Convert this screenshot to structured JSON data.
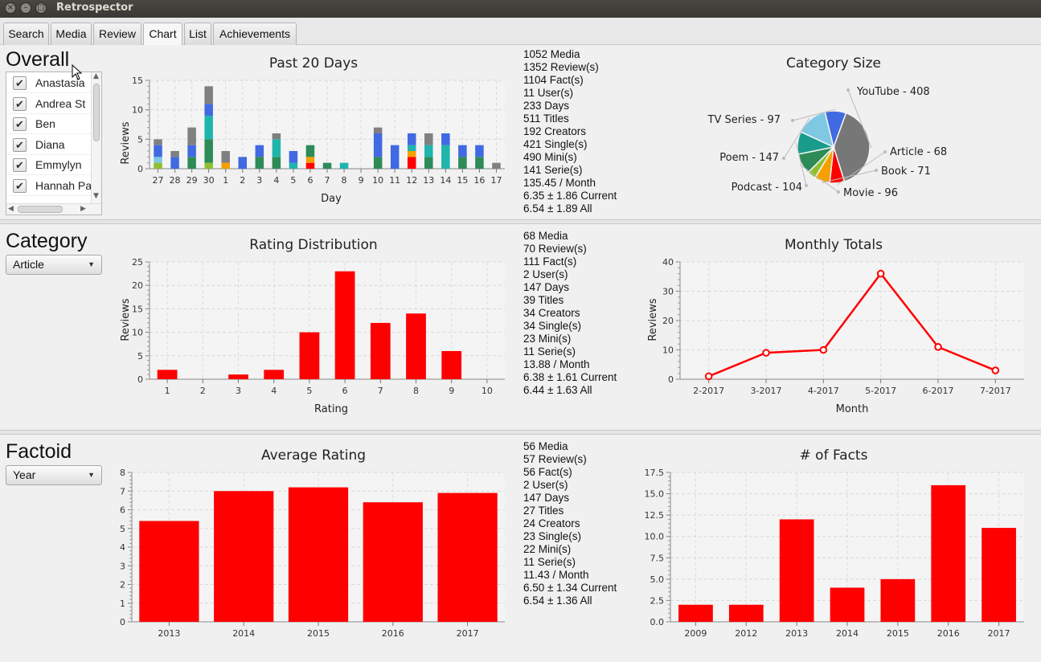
{
  "window": {
    "title": "Retrospector"
  },
  "tabs": [
    "Search",
    "Media",
    "Review",
    "Chart",
    "List",
    "Achievements"
  ],
  "active_tab": "Chart",
  "overall": {
    "title": "Overall",
    "users": [
      "Anastasia",
      "Andrea St",
      "Ben",
      "Diana",
      "Emmylyn",
      "Hannah Pa"
    ],
    "stats": [
      "1052 Media",
      "1352 Review(s)",
      "1104 Fact(s)",
      "11 User(s)",
      "233 Days",
      "511 Titles",
      "192 Creators",
      "421 Single(s)",
      "490 Mini(s)",
      "141 Serie(s)",
      "135.45 / Month",
      "6.35 ± 1.86 Current",
      "6.54 ± 1.89 All"
    ]
  },
  "category": {
    "title": "Category",
    "selected": "Article",
    "stats": [
      "68 Media",
      "70 Review(s)",
      "111 Fact(s)",
      "2 User(s)",
      "147 Days",
      "39 Titles",
      "34 Creators",
      "34 Single(s)",
      "23 Mini(s)",
      "11 Serie(s)",
      "13.88 / Month",
      "6.38 ± 1.61 Current",
      "6.44 ± 1.63 All"
    ]
  },
  "factoid": {
    "title": "Factoid",
    "selected": "Year",
    "stats": [
      "56 Media",
      "57 Review(s)",
      "56 Fact(s)",
      "2 User(s)",
      "147 Days",
      "27 Titles",
      "24 Creators",
      "23 Single(s)",
      "22 Mini(s)",
      "11 Serie(s)",
      "11.43 / Month",
      "6.50 ± 1.34 Current",
      "6.54 ± 1.36 All"
    ]
  },
  "colors": {
    "red": "#ff0000",
    "orange": "#f5a000",
    "yellowgreen": "#8fbf30",
    "darkgreen": "#2e8b57",
    "teal": "#1fb5ad",
    "lightblue": "#7ec8e3",
    "blue": "#4169e1",
    "gray": "#808080",
    "seagreen": "#1a9c8c"
  },
  "chart_data": [
    {
      "type": "bar",
      "stacked": true,
      "title": "Past 20 Days",
      "xlabel": "Day",
      "ylabel": "Reviews",
      "ylim": [
        0,
        15
      ],
      "yticks": [
        0,
        5,
        10,
        15
      ],
      "categories": [
        "27",
        "28",
        "29",
        "30",
        "1",
        "2",
        "3",
        "4",
        "5",
        "6",
        "7",
        "8",
        "9",
        "10",
        "11",
        "12",
        "13",
        "14",
        "15",
        "16",
        "17"
      ],
      "stacks": [
        [
          [
            "yellowgreen",
            1
          ],
          [
            "lightblue",
            1
          ],
          [
            "blue",
            2
          ],
          [
            "gray",
            1
          ]
        ],
        [
          [
            "blue",
            2
          ],
          [
            "gray",
            1
          ]
        ],
        [
          [
            "darkgreen",
            2
          ],
          [
            "blue",
            2
          ],
          [
            "gray",
            3
          ]
        ],
        [
          [
            "yellowgreen",
            1
          ],
          [
            "darkgreen",
            4
          ],
          [
            "teal",
            4
          ],
          [
            "blue",
            2
          ],
          [
            "gray",
            3
          ]
        ],
        [
          [
            "orange",
            1
          ],
          [
            "gray",
            2
          ]
        ],
        [
          [
            "blue",
            2
          ]
        ],
        [
          [
            "darkgreen",
            2
          ],
          [
            "blue",
            2
          ]
        ],
        [
          [
            "darkgreen",
            2
          ],
          [
            "teal",
            3
          ],
          [
            "gray",
            1
          ]
        ],
        [
          [
            "teal",
            1
          ],
          [
            "blue",
            2
          ]
        ],
        [
          [
            "red",
            1
          ],
          [
            "orange",
            1
          ],
          [
            "darkgreen",
            2
          ]
        ],
        [
          [
            "darkgreen",
            1
          ]
        ],
        [
          [
            "teal",
            1
          ]
        ],
        [],
        [
          [
            "darkgreen",
            2
          ],
          [
            "blue",
            4
          ],
          [
            "gray",
            1
          ]
        ],
        [
          [
            "blue",
            4
          ]
        ],
        [
          [
            "red",
            2
          ],
          [
            "orange",
            1
          ],
          [
            "teal",
            1
          ],
          [
            "blue",
            2
          ]
        ],
        [
          [
            "darkgreen",
            2
          ],
          [
            "teal",
            2
          ],
          [
            "gray",
            2
          ]
        ],
        [
          [
            "teal",
            4
          ],
          [
            "blue",
            2
          ]
        ],
        [
          [
            "darkgreen",
            2
          ],
          [
            "blue",
            2
          ]
        ],
        [
          [
            "darkgreen",
            2
          ],
          [
            "blue",
            2
          ]
        ],
        [
          [
            "gray",
            1
          ]
        ]
      ]
    },
    {
      "type": "pie",
      "title": "Category Size",
      "slices": [
        {
          "label": "YouTube - 408",
          "value": 408,
          "color": "#777777"
        },
        {
          "label": "Article - 68",
          "value": 68,
          "color": "#ff0000"
        },
        {
          "label": "Book - 71",
          "value": 71,
          "color": "#f5a000"
        },
        {
          "label": "",
          "value": 40,
          "color": "#8fbf30"
        },
        {
          "label": "Movie - 96",
          "value": 96,
          "color": "#2e8b57"
        },
        {
          "label": "Podcast - 104",
          "value": 104,
          "color": "#1a9c8c"
        },
        {
          "label": "Poem - 147",
          "value": 147,
          "color": "#7ec8e3"
        },
        {
          "label": "TV Series - 97",
          "value": 97,
          "color": "#4169e1"
        }
      ]
    },
    {
      "type": "bar",
      "title": "Rating Distribution",
      "xlabel": "Rating",
      "ylabel": "Reviews",
      "ylim": [
        0,
        25
      ],
      "yticks": [
        0,
        5,
        10,
        15,
        20,
        25
      ],
      "categories": [
        "1",
        "2",
        "3",
        "4",
        "5",
        "6",
        "7",
        "8",
        "9",
        "10"
      ],
      "values": [
        2,
        0,
        1,
        2,
        10,
        23,
        12,
        14,
        6,
        0
      ]
    },
    {
      "type": "line",
      "title": "Monthly Totals",
      "xlabel": "Month",
      "ylabel": "Reviews",
      "ylim": [
        0,
        40
      ],
      "yticks": [
        0,
        10,
        20,
        30,
        40
      ],
      "categories": [
        "2-2017",
        "3-2017",
        "4-2017",
        "5-2017",
        "6-2017",
        "7-2017"
      ],
      "values": [
        1,
        9,
        10,
        36,
        11,
        3
      ]
    },
    {
      "type": "bar",
      "title": "Average Rating",
      "xlabel": "",
      "ylabel": "",
      "ylim": [
        0,
        8
      ],
      "yticks": [
        0,
        1,
        2,
        3,
        4,
        5,
        6,
        7,
        8
      ],
      "categories": [
        "2013",
        "2014",
        "2015",
        "2016",
        "2017"
      ],
      "values": [
        5.4,
        7.0,
        7.2,
        6.4,
        6.9
      ]
    },
    {
      "type": "bar",
      "title": "# of Facts",
      "xlabel": "",
      "ylabel": "",
      "ylim": [
        0,
        17.5
      ],
      "yticks": [
        "0.0",
        "2.5",
        "5.0",
        "7.5",
        "10.0",
        "12.5",
        "15.0",
        "17.5"
      ],
      "categories": [
        "2009",
        "2012",
        "2013",
        "2014",
        "2015",
        "2016",
        "2017"
      ],
      "values": [
        2,
        2,
        12,
        4,
        5,
        16,
        11
      ]
    }
  ]
}
